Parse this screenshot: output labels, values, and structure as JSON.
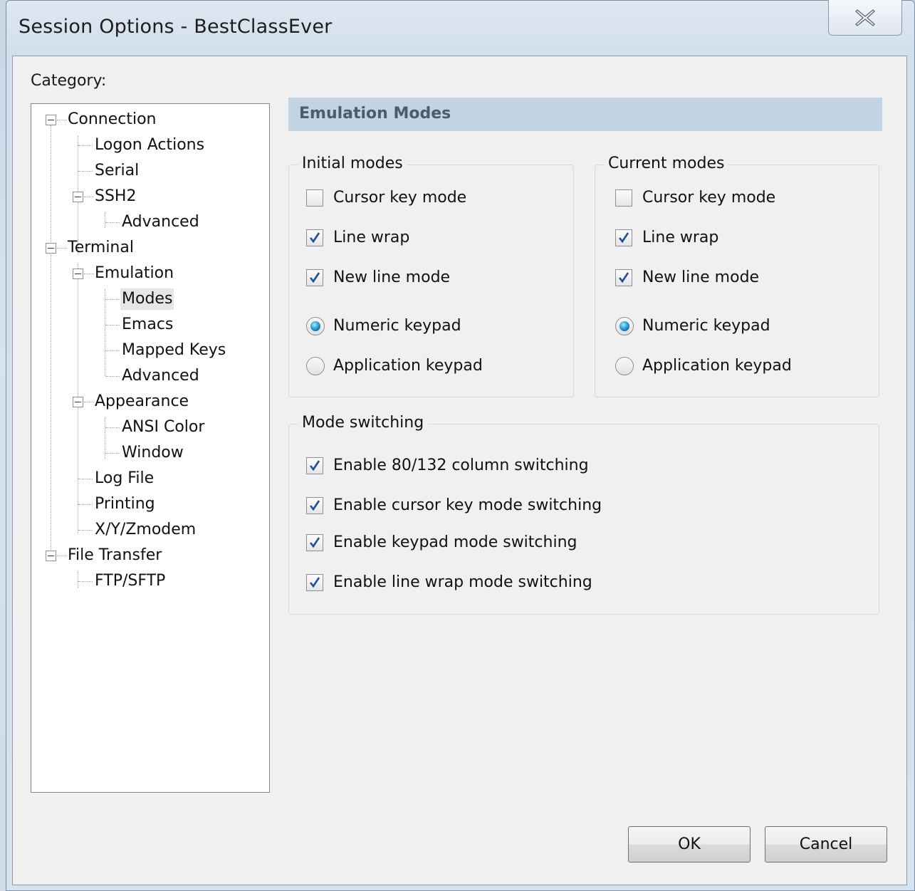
{
  "window": {
    "title": "Session Options - BestClassEver",
    "close_icon": "close-icon"
  },
  "category_label": "Category:",
  "tree": {
    "connection": "Connection",
    "logon_actions": "Logon Actions",
    "serial": "Serial",
    "ssh2": "SSH2",
    "ssh2_advanced": "Advanced",
    "terminal": "Terminal",
    "emulation": "Emulation",
    "modes": "Modes",
    "emacs": "Emacs",
    "mapped_keys": "Mapped Keys",
    "emulation_advanced": "Advanced",
    "appearance": "Appearance",
    "ansi_color": "ANSI Color",
    "window": "Window",
    "log_file": "Log File",
    "printing": "Printing",
    "xyzmodem": "X/Y/Zmodem",
    "file_transfer": "File Transfer",
    "ftp_sftp": "FTP/SFTP",
    "selected": "Modes"
  },
  "panel_title": "Emulation Modes",
  "initial_modes": {
    "title": "Initial modes",
    "cursor_key_mode": {
      "label": "Cursor key mode",
      "checked": false
    },
    "line_wrap": {
      "label": "Line wrap",
      "checked": true
    },
    "new_line_mode": {
      "label": "New line mode",
      "checked": true
    },
    "numeric_keypad": {
      "label": "Numeric keypad",
      "selected": true
    },
    "application_keypad": {
      "label": "Application keypad",
      "selected": false
    }
  },
  "current_modes": {
    "title": "Current modes",
    "cursor_key_mode": {
      "label": "Cursor key mode",
      "checked": false
    },
    "line_wrap": {
      "label": "Line wrap",
      "checked": true
    },
    "new_line_mode": {
      "label": "New line mode",
      "checked": true
    },
    "numeric_keypad": {
      "label": "Numeric keypad",
      "selected": true
    },
    "application_keypad": {
      "label": "Application keypad",
      "selected": false
    }
  },
  "mode_switching": {
    "title": "Mode switching",
    "col_switching": {
      "label": "Enable 80/132 column switching",
      "checked": true
    },
    "cursor_key_switching": {
      "label": "Enable cursor key mode switching",
      "checked": true
    },
    "keypad_switching": {
      "label": "Enable keypad mode switching",
      "checked": true
    },
    "line_wrap_switching": {
      "label": "Enable line wrap mode switching",
      "checked": true
    }
  },
  "buttons": {
    "ok": "OK",
    "cancel": "Cancel"
  },
  "colors": {
    "header_bg": "#c2d3e2",
    "header_text": "#4a5c70",
    "radio_accent": "#2ca0d6",
    "check": "#1d4f9a"
  }
}
